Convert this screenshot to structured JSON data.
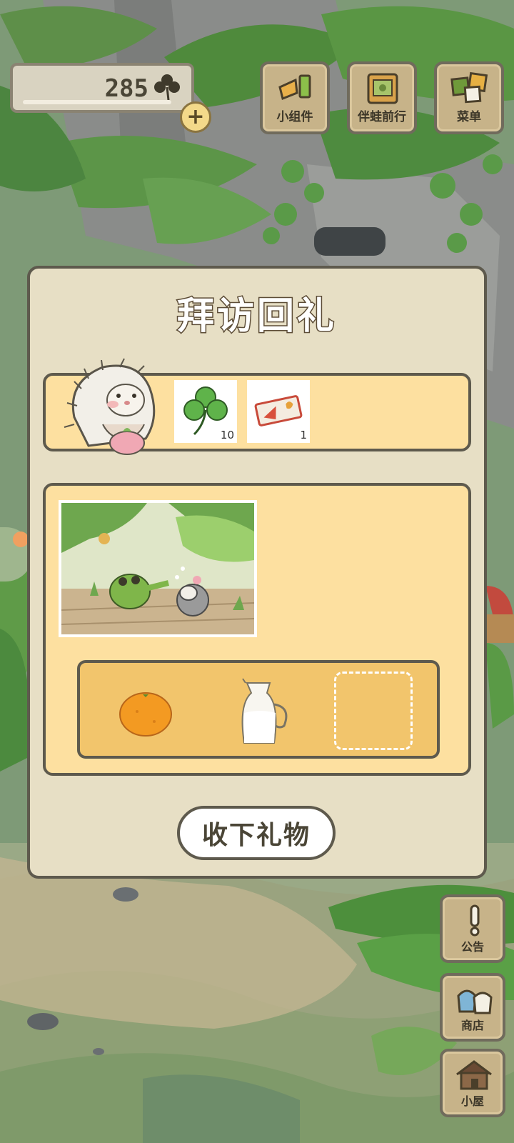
{
  "hud": {
    "clover_count": "285",
    "plus_label": "+"
  },
  "top_menu": [
    {
      "label": "小组件",
      "icon": "widget-icon"
    },
    {
      "label": "伴蛙前行",
      "icon": "travel-frame-icon"
    },
    {
      "label": "菜单",
      "icon": "menu-cards-icon"
    }
  ],
  "side_menu": [
    {
      "label": "公告",
      "icon": "exclamation-icon"
    },
    {
      "label": "商店",
      "icon": "shop-bags-icon"
    },
    {
      "label": "小屋",
      "icon": "house-icon"
    }
  ],
  "dialog": {
    "title": "拜访回礼",
    "visitor": "hedgehog-visitor-icon",
    "rewards": [
      {
        "item": "clover-icon",
        "count": "10"
      },
      {
        "item": "ticket-icon",
        "count": "1"
      }
    ],
    "photo": "frog-and-hedgehog-photo",
    "gifts": [
      "orange-icon",
      "milk-jug-icon",
      "empty-slot"
    ],
    "collect_button": "收下礼物"
  },
  "colors": {
    "panel_bg": "#e7dfc5",
    "panel_inner": "#fde0a0",
    "tray": "#f2c56c",
    "border": "#5e5a4d",
    "button_wood": "#c7b389"
  }
}
